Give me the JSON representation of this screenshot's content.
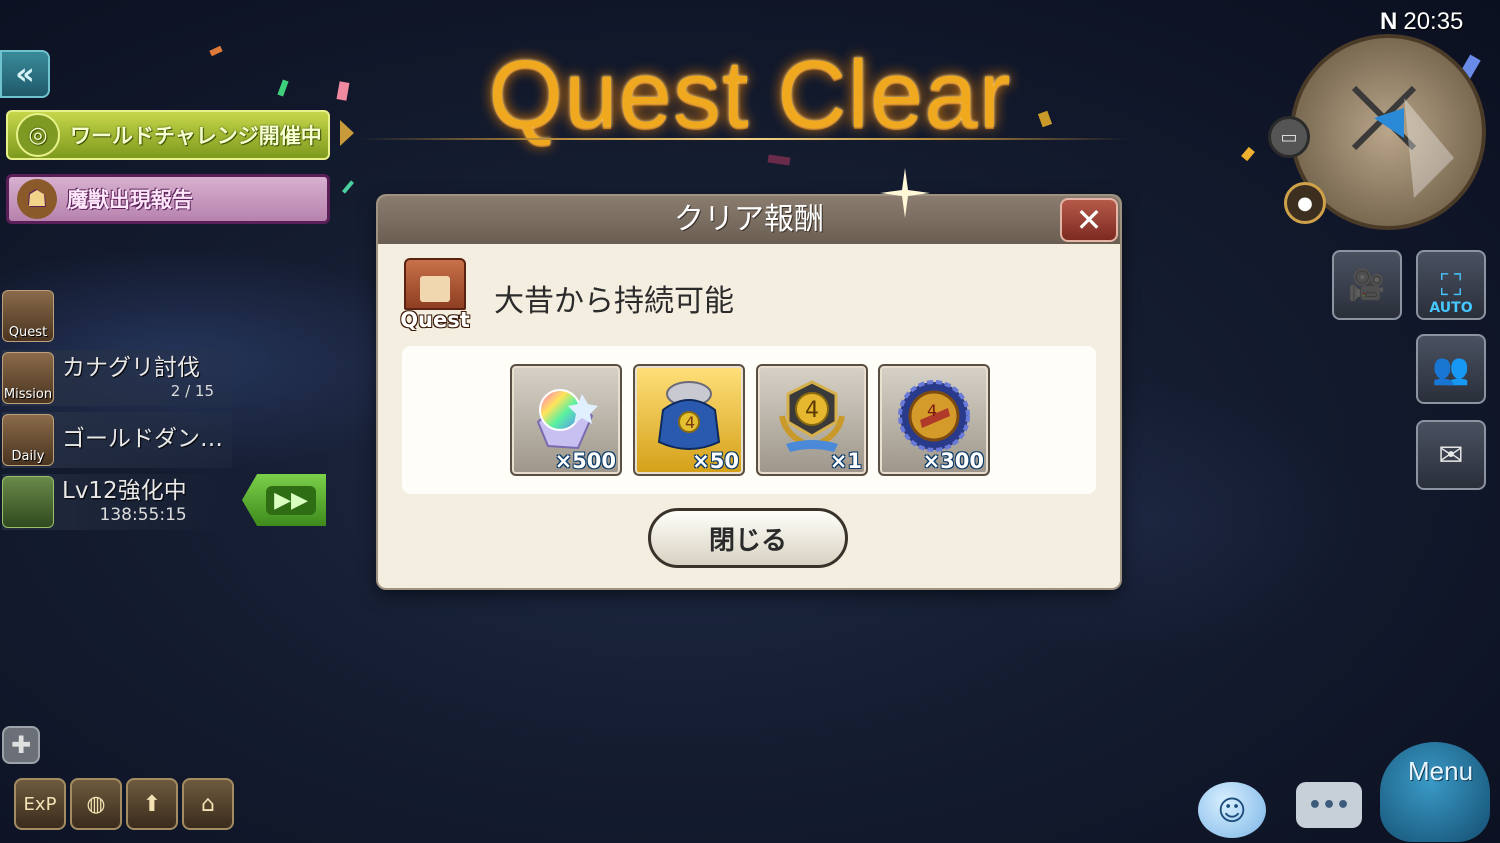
{
  "title": "Quest Clear",
  "clock": {
    "compass": "N",
    "time": "20:35"
  },
  "left_panel": {
    "world_banner": "ワールドチャレンジ開催中",
    "beast_banner": "魔獣出現報告",
    "rows": [
      {
        "tag": "Quest",
        "text": "",
        "sub": ""
      },
      {
        "tag": "Mission",
        "text": "カナグリ討伐",
        "sub": "2 / 15"
      },
      {
        "tag": "Daily",
        "text": "ゴールドダン…",
        "sub": ""
      },
      {
        "tag": "",
        "text": "Lv12強化中",
        "sub": "138:55:15"
      }
    ],
    "bottom_icons": [
      "ExP",
      "compass-icon",
      "boot-icon",
      "gift-icon"
    ]
  },
  "modal": {
    "header": "クリア報酬",
    "close_icon": "✕",
    "quest_tag": "Quest",
    "quest_name": "大昔から持続可能",
    "rewards": [
      {
        "icon": "rainbow-crystal-icon",
        "qty": "×500",
        "frame": "silver"
      },
      {
        "icon": "treasure-bag-icon",
        "qty": "×50",
        "frame": "gold"
      },
      {
        "icon": "rank-emblem-icon",
        "qty": "×1",
        "frame": "silver"
      },
      {
        "icon": "medal-coin-icon",
        "qty": "×300",
        "frame": "silver"
      }
    ],
    "close_button": "閉じる"
  },
  "right_panel": {
    "auto_label": "AUTO",
    "menu_label": "Menu"
  },
  "colors": {
    "title_gold": "#f0a81e",
    "world_banner": "#a9be34",
    "beast_banner": "#c89ac0",
    "modal_bg": "#f3eedf",
    "modal_header": "#7a6e62"
  }
}
